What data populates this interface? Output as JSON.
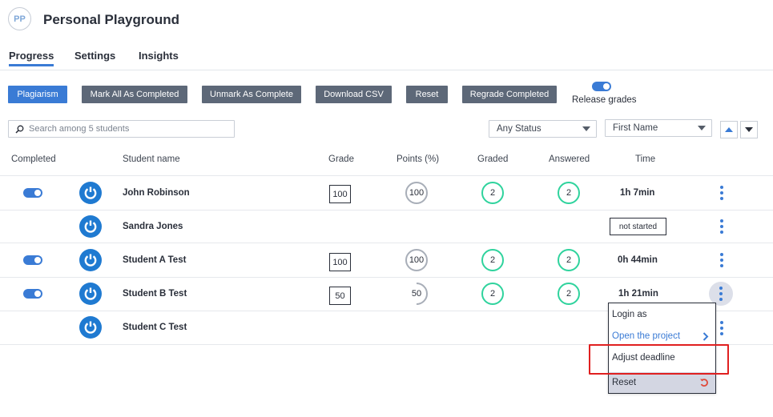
{
  "header": {
    "avatar_initials": "PP",
    "title": "Personal Playground"
  },
  "tabs": [
    {
      "label": "Progress",
      "active": true
    },
    {
      "label": "Settings",
      "active": false
    },
    {
      "label": "Insights",
      "active": false
    }
  ],
  "toolbar": {
    "plagiarism": "Plagiarism",
    "mark_all": "Mark All As Completed",
    "unmark": "Unmark As Complete",
    "download_csv": "Download CSV",
    "reset": "Reset",
    "regrade": "Regrade Completed",
    "release_grades": "Release grades",
    "release_grades_on": true
  },
  "filters": {
    "search_placeholder": "Search among 5 students",
    "status": "Any Status",
    "sort_by": "First Name"
  },
  "columns": {
    "completed": "Completed",
    "student_name": "Student name",
    "grade": "Grade",
    "points": "Points (%)",
    "graded": "Graded",
    "answered": "Answered",
    "time": "Time"
  },
  "students": [
    {
      "completed": true,
      "name": "John Robinson",
      "grade": "100",
      "points": "100",
      "graded": "2",
      "answered": "2",
      "time": "1h 7min"
    },
    {
      "completed": false,
      "name": "Sandra Jones",
      "grade": "",
      "points": "",
      "graded": "",
      "answered": "",
      "time": "not started"
    },
    {
      "completed": true,
      "name": "Student A Test",
      "grade": "100",
      "points": "100",
      "graded": "2",
      "answered": "2",
      "time": "0h 44min"
    },
    {
      "completed": true,
      "name": "Student B Test",
      "grade": "50",
      "points": "50",
      "graded": "2",
      "answered": "2",
      "time": "1h 21min"
    },
    {
      "completed": false,
      "name": "Student C Test",
      "grade": "",
      "points": "",
      "graded": "",
      "answered": "",
      "time": ""
    }
  ],
  "context_menu": {
    "login_as": "Login as",
    "open_project": "Open the project",
    "adjust_deadline": "Adjust deadline",
    "reset": "Reset"
  },
  "colors": {
    "accent": "#3a7bd5",
    "button_grey": "#5d6878",
    "graded_green": "#2fd39d",
    "highlight_red": "#e02020"
  }
}
